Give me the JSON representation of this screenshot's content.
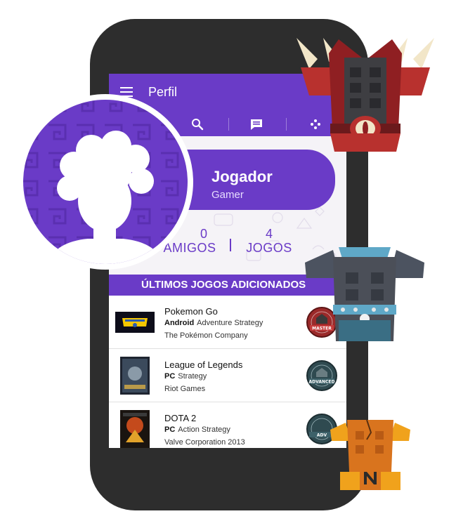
{
  "header": {
    "title": "Perfil"
  },
  "icons": {
    "menu": "menu-icon",
    "search": "search-icon",
    "chat": "chat-icon",
    "games": "gamepad-icon"
  },
  "profile": {
    "name": "Jogador",
    "tag": "Gamer",
    "friends_count": "0",
    "friends_label": "AMIGOS",
    "games_count": "4",
    "games_label": "JOGOS",
    "stats_separator": "|"
  },
  "section": {
    "title": "ÚLTIMOS JOGOS ADICIONADOS"
  },
  "games": [
    {
      "title": "Pokemon Go",
      "platform": "Android",
      "genre": "Adventure Strategy",
      "developer": "The Pokémon Company",
      "badge": "MASTER",
      "badge_color": "#9b2a2a"
    },
    {
      "title": "League of Legends",
      "platform": "PC",
      "genre": "Strategy",
      "developer": "Riot Games",
      "badge": "ADVANCED",
      "badge_color": "#2f4a50"
    },
    {
      "title": "DOTA 2",
      "platform": "PC",
      "genre": "Action Strategy",
      "developer": "Valve Corporation 2013",
      "badge": "ADV",
      "badge_color": "#2f4a50"
    }
  ],
  "colors": {
    "primary": "#6a3bc7",
    "phone_body": "#2d2d2d",
    "screen_bg": "#f5f3f7"
  }
}
